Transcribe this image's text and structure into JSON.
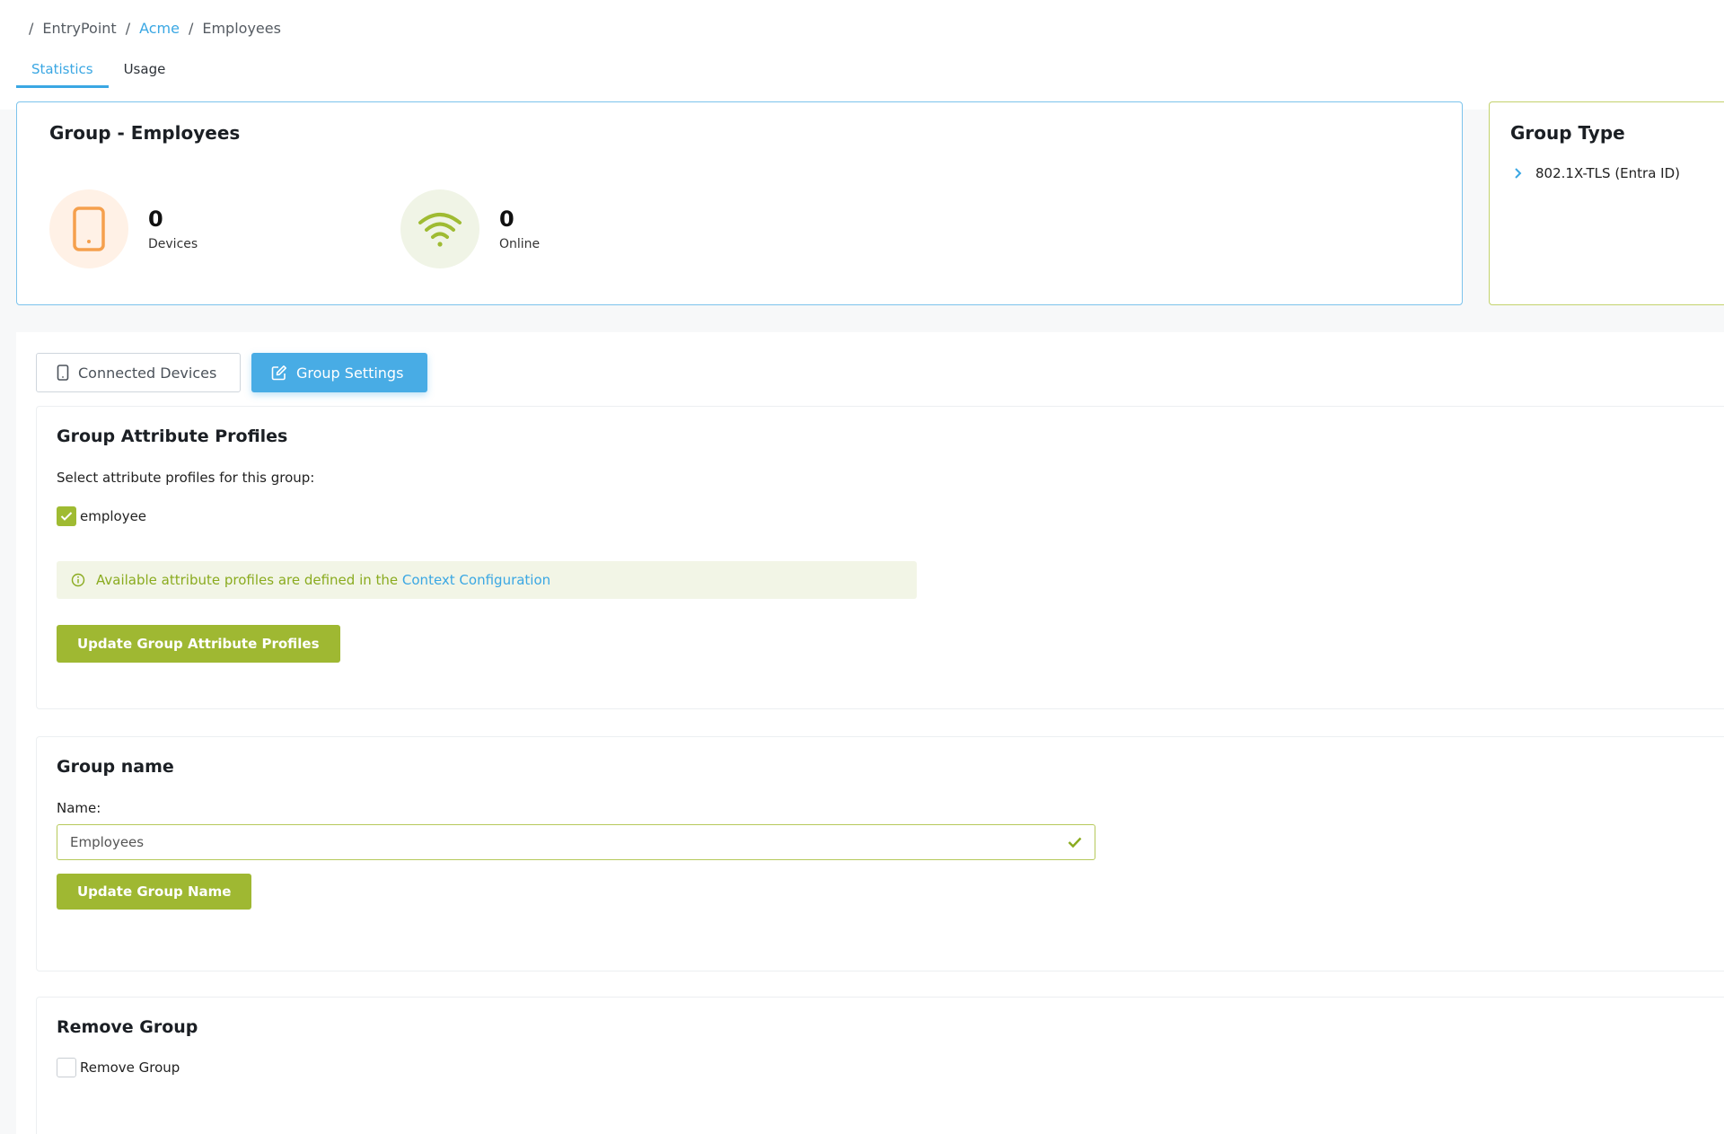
{
  "breadcrumb": {
    "separator": "/",
    "root": "EntryPoint",
    "parent": "Acme",
    "current": "Employees"
  },
  "tabs": [
    {
      "label": "Statistics",
      "active": true
    },
    {
      "label": "Usage",
      "active": false
    }
  ],
  "stats_card": {
    "title": "Group - Employees",
    "devices": {
      "value": "0",
      "label": "Devices",
      "icon": "tablet-icon"
    },
    "online": {
      "value": "0",
      "label": "Online",
      "icon": "wifi-icon"
    }
  },
  "group_type": {
    "title": "Group Type",
    "item": "802.1X-TLS (Entra ID)"
  },
  "settings_tabs": {
    "connected_devices": "Connected Devices",
    "group_settings": "Group Settings"
  },
  "attribute_profiles": {
    "title": "Group Attribute Profiles",
    "instruction": "Select attribute profiles for this group:",
    "profiles": [
      {
        "label": "employee",
        "checked": true
      }
    ],
    "info_text": "Available attribute profiles are defined in the ",
    "info_link": "Context Configuration",
    "button": "Update Group Attribute Profiles"
  },
  "group_name": {
    "title": "Group name",
    "label": "Name:",
    "value": "Employees",
    "button": "Update Group Name"
  },
  "remove_group": {
    "title": "Remove Group",
    "checkbox_label": "Remove Group",
    "checked": false
  },
  "colors": {
    "accent_blue": "#3aa7e3",
    "accent_green": "#9fb832",
    "orange": "#f5a04d"
  }
}
